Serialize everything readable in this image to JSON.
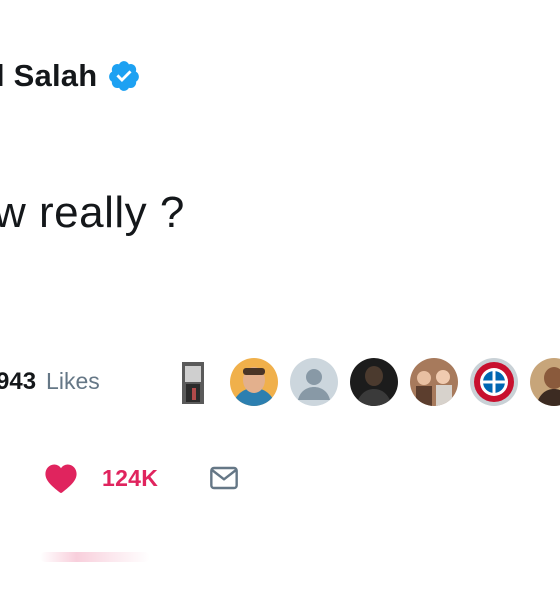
{
  "tweet": {
    "author_name": "l Salah",
    "text": "w really ?",
    "likes_count": "943",
    "likes_label": "Likes",
    "like_button_count": "124K"
  },
  "icons": {
    "verified": "verified-badge-icon",
    "like": "heart-icon",
    "direct_message": "mail-icon"
  },
  "colors": {
    "verified": "#1da1f2",
    "like": "#e0245e",
    "muted": "#657786",
    "text": "#14171a"
  }
}
